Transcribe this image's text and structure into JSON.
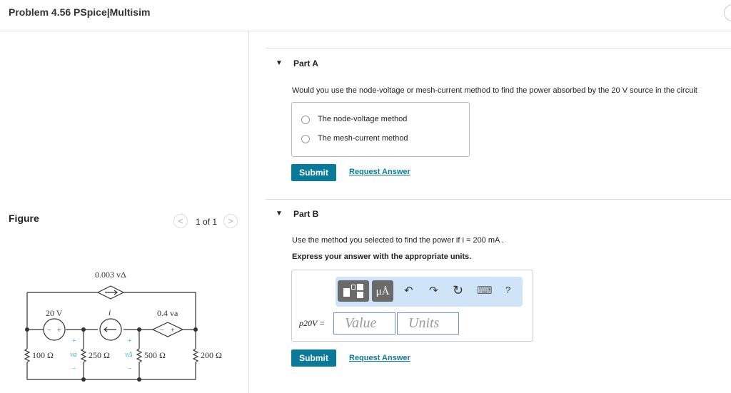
{
  "header": {
    "title": "Problem 4.56 PSpice|Multisim"
  },
  "figure": {
    "label": "Figure",
    "pager": "1 of 1",
    "prev": "<",
    "next": ">",
    "circuit": {
      "ccs": "0.003 vΔ",
      "vsrc": "20 V",
      "isrc": "i",
      "vcvs": "0.4 va",
      "r1": "100 Ω",
      "r2": "250 Ω",
      "r3": "500 Ω",
      "r4": "200 Ω",
      "va": "va",
      "vd": "vΔ",
      "plus": "+",
      "minus": "−"
    }
  },
  "partA": {
    "title": "Part A",
    "question": "Would you use the node-voltage or mesh-current method to find the power absorbed by the 20 V source in the circuit",
    "options": [
      "The node-voltage method",
      "The mesh-current method"
    ],
    "submit": "Submit",
    "request": "Request Answer"
  },
  "partB": {
    "title": "Part B",
    "question": "Use the method you selected to find the power if i = 200 mA .",
    "instruction": "Express your answer with the appropriate units.",
    "toolbar": {
      "units": "μÅ",
      "undo": "↶",
      "redo": "↷",
      "reset": "↻",
      "keyboard": "⌨",
      "help": "?"
    },
    "var_label": "p20V =",
    "value_placeholder": "Value",
    "units_placeholder": "Units",
    "submit": "Submit",
    "request": "Request Answer"
  }
}
